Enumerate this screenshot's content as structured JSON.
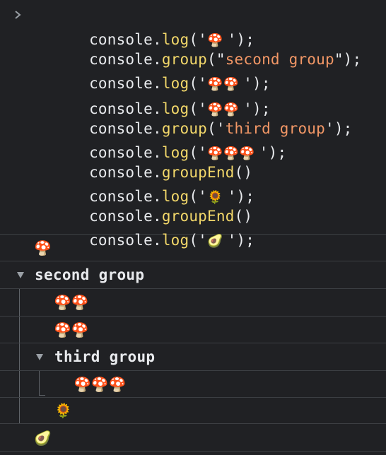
{
  "input": {
    "lines": [
      {
        "obj": "console",
        "method": "log",
        "open": "('",
        "arg": "🍄 ",
        "close": "');",
        "arg_is_string": false
      },
      {
        "obj": "console",
        "method": "group",
        "open": "(\"",
        "arg": "second group",
        "close": "\");",
        "arg_is_string": true
      },
      {
        "obj": "console",
        "method": "log",
        "open": "('",
        "arg": "🍄🍄 ",
        "close": "');",
        "arg_is_string": false
      },
      {
        "obj": "console",
        "method": "log",
        "open": "('",
        "arg": "🍄🍄 ",
        "close": "');",
        "arg_is_string": false
      },
      {
        "obj": "console",
        "method": "group",
        "open": "('",
        "arg": "third group",
        "close": "');",
        "arg_is_string": true
      },
      {
        "obj": "console",
        "method": "log",
        "open": "('",
        "arg": "🍄🍄🍄 ",
        "close": "');",
        "arg_is_string": false
      },
      {
        "obj": "console",
        "method": "groupEnd",
        "open": "()",
        "arg": "",
        "close": "",
        "arg_is_string": false
      },
      {
        "obj": "console",
        "method": "log",
        "open": "('",
        "arg": "🌻 ",
        "close": "');",
        "arg_is_string": false
      },
      {
        "obj": "console",
        "method": "groupEnd",
        "open": "()",
        "arg": "",
        "close": "",
        "arg_is_string": false
      },
      {
        "obj": "console",
        "method": "log",
        "open": "('",
        "arg": "🥑 ",
        "close": "');",
        "arg_is_string": false
      }
    ]
  },
  "output": {
    "row1": "🍄",
    "group2_label": "second group",
    "row2": "🍄🍄",
    "row3": "🍄🍄",
    "group3_label": "third group",
    "row4": "🍄🍄🍄",
    "row5": "🌻",
    "row6": "🥑"
  },
  "colors": {
    "background": "#202124",
    "method": "#f3d86a",
    "string": "#f29766",
    "text": "#e8eaed",
    "divider": "#3c3f43"
  },
  "icons": {
    "prompt": "chevron-right-icon",
    "expand": "triangle-down-icon"
  }
}
